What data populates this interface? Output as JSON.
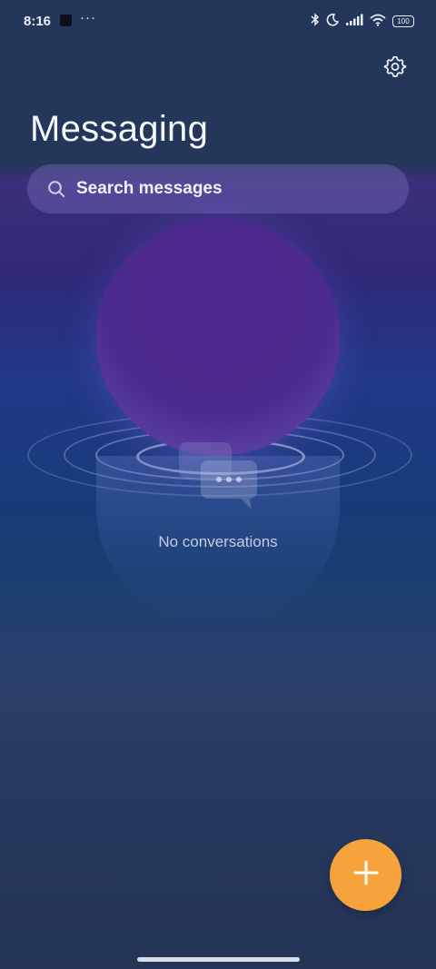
{
  "status_bar": {
    "time": "8:16",
    "more": "···",
    "battery": "100"
  },
  "header": {
    "title": "Messaging",
    "settings_icon": "gear-icon"
  },
  "search": {
    "placeholder": "Search messages",
    "icon": "search-icon"
  },
  "empty_state": {
    "label": "No conversations",
    "icon": "chat-bubbles-icon"
  },
  "fab": {
    "icon": "plus-icon",
    "color": "#f7a33b"
  },
  "colors": {
    "background": "#243557",
    "accent": "#f7a33b",
    "sphere": "#4a2a8c"
  }
}
